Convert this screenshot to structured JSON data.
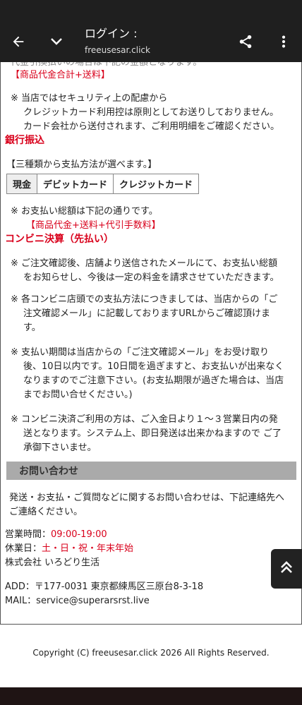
{
  "toolbar": {
    "title": "ログイン :",
    "url": "freeusesar.click",
    "back_icon": "arrow-left-icon",
    "chevron_icon": "chevron-down-icon",
    "share_icon": "share-icon",
    "more_icon": "more-vert-icon"
  },
  "content": {
    "partial_top": "代金引換払いの場合は下記の金額となります。",
    "credit_total": "【商品代金合計+送料】",
    "credit_note_1": "※ 当店ではセキュリティ上の配慮から",
    "credit_note_2": "クレジットカード利用控は原則としてお送りしておりません。",
    "credit_note_3": "カード会社から送付されます、ご利用明細をご確認ください。",
    "bank_heading": "銀行振込",
    "bank_intro": "【三種類から支払方法が選べます。】",
    "pay_methods": [
      "現金",
      "デビットカード",
      "クレジットカード"
    ],
    "cod_note": "※ お支払い総額は下記の通りです。",
    "cod_total": "【商品代金+送料+代引手数料】",
    "conv_heading": "コンビニ決算（先払い）",
    "conv_1a": "※ ご注文確認後、店舗より送信されたメールにて、お支払い総額",
    "conv_1b": "をお知らせし、今後は一定の料金を請求させていただきます。",
    "conv_2a": "※ 各コンビニ店頭での支払方法につきましては、当店からの「ご",
    "conv_2b": "注文確認メール」に記載しておりますURLからご確認頂けま",
    "conv_2c": "す。",
    "conv_3a": "※ 支払い期間は当店からの「ご注文確認メール」をお受け取り",
    "conv_3b": "後、10日以内です。10日間を過ぎますと、お支払いが出来なく",
    "conv_3c": "なりますのでご注意下さい。(お支払期限が過ぎた場合は、当店",
    "conv_3d": "までお問い合せください。)",
    "conv_4a": "※ コンビニ決済ご利用の方は、ご入金日より１～３営業日内の発",
    "conv_4b": "送となります。システム上、即日発送は出来かねますので ご了",
    "conv_4c": "承御下さいませ。",
    "contact_heading": "お問い合わせ",
    "contact_1": "発送・お支払・ご質問などに関するお問い合わせは、下記連絡先へ",
    "contact_2": "ご連絡ください。",
    "hours_label": "営業時間：",
    "hours_value": "09:00-19:00",
    "holiday_label": "休業日：",
    "holiday_value": "土・日・祝・年末年始",
    "company": "株式会社 いろどり生活",
    "address": "ADD：〒177-0031 東京都練馬区三原台8-3-18",
    "mail": "MAIL：service@superarsrst.live"
  },
  "scrolltop_icon": "double-chevron-up-icon",
  "footer": {
    "copyright": "Copyright (C) freeusesar.click 2026 All Rights Reserved."
  }
}
